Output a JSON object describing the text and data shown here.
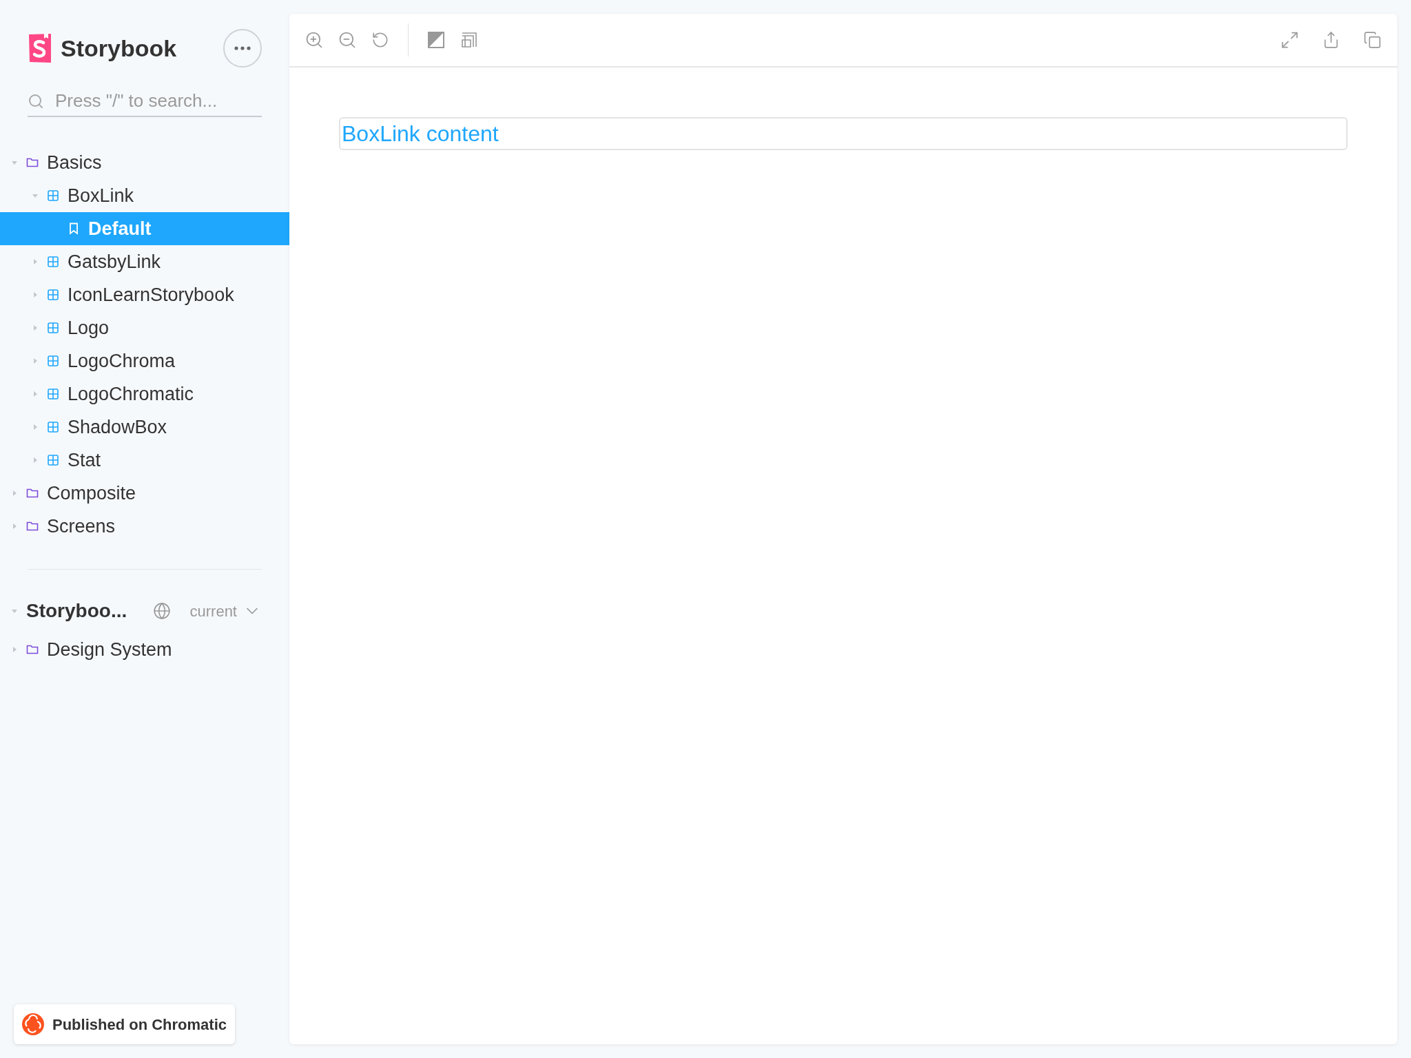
{
  "brand": {
    "title": "Storybook"
  },
  "search": {
    "placeholder": "Press \"/\" to search..."
  },
  "tree": [
    {
      "kind": "folder",
      "label": "Basics",
      "expanded": true,
      "selected": false,
      "children": [
        {
          "kind": "component",
          "label": "BoxLink",
          "expanded": true,
          "selected": false,
          "children": [
            {
              "kind": "story",
              "label": "Default",
              "selected": true
            }
          ]
        },
        {
          "kind": "component",
          "label": "GatsbyLink",
          "expanded": false,
          "selected": false
        },
        {
          "kind": "component",
          "label": "IconLearnStorybook",
          "expanded": false,
          "selected": false
        },
        {
          "kind": "component",
          "label": "Logo",
          "expanded": false,
          "selected": false
        },
        {
          "kind": "component",
          "label": "LogoChroma",
          "expanded": false,
          "selected": false
        },
        {
          "kind": "component",
          "label": "LogoChromatic",
          "expanded": false,
          "selected": false
        },
        {
          "kind": "component",
          "label": "ShadowBox",
          "expanded": false,
          "selected": false
        },
        {
          "kind": "component",
          "label": "Stat",
          "expanded": false,
          "selected": false
        }
      ]
    },
    {
      "kind": "folder",
      "label": "Composite",
      "expanded": false,
      "selected": false
    },
    {
      "kind": "folder",
      "label": "Screens",
      "expanded": false,
      "selected": false
    }
  ],
  "ref": {
    "title": "Storyboo...",
    "version": "current",
    "expanded": true,
    "tree": [
      {
        "kind": "folder",
        "label": "Design System",
        "expanded": false,
        "selected": false
      }
    ]
  },
  "preview": {
    "link_text": "BoxLink content"
  },
  "badge": {
    "label": "Published on Chromatic"
  }
}
